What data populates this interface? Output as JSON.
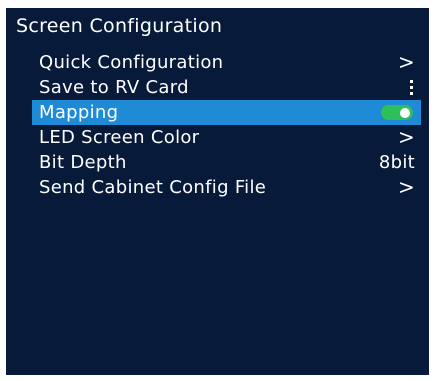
{
  "title": "Screen Configuration",
  "menu": {
    "items": [
      {
        "label": "Quick Configuration",
        "right": ">",
        "right_icon": "chevron-right-icon"
      },
      {
        "label": "Save to RV Card",
        "right_icon": "more-vertical-icon"
      },
      {
        "label": "Mapping",
        "right_icon": "toggle-switch",
        "toggle_state": "on",
        "selected": true
      },
      {
        "label": "LED Screen Color",
        "right": ">",
        "right_icon": "chevron-right-icon"
      },
      {
        "label": "Bit Depth",
        "value": "8bit"
      },
      {
        "label": "Send Cabinet Config File",
        "right": ">",
        "right_icon": "chevron-right-icon"
      }
    ]
  },
  "colors": {
    "background": "#081a3a",
    "selection": "#1f8ad6",
    "toggle_on": "#2fbf5a",
    "text": "#ffffff"
  }
}
